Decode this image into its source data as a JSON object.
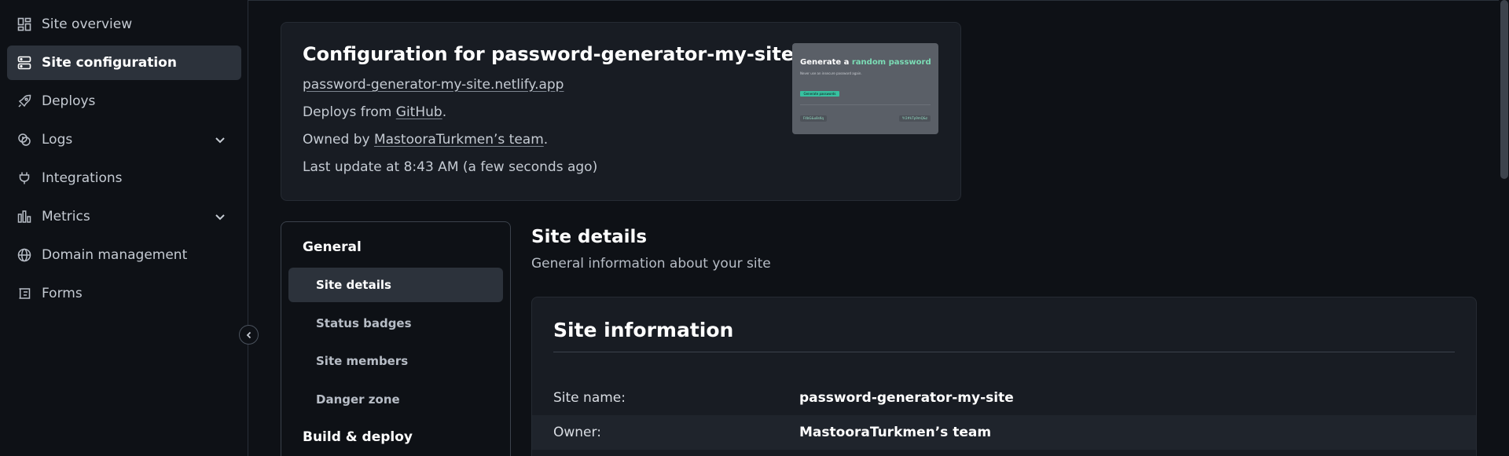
{
  "sidebar": {
    "items": [
      {
        "label": "Site overview",
        "icon": "grid-icon"
      },
      {
        "label": "Site configuration",
        "icon": "server-icon"
      },
      {
        "label": "Deploys",
        "icon": "rocket-icon"
      },
      {
        "label": "Logs",
        "icon": "logs-icon"
      },
      {
        "label": "Integrations",
        "icon": "plug-icon"
      },
      {
        "label": "Metrics",
        "icon": "bar-chart-icon"
      },
      {
        "label": "Domain management",
        "icon": "globe-icon"
      },
      {
        "label": "Forms",
        "icon": "form-icon"
      }
    ],
    "active_item": "Site configuration"
  },
  "config": {
    "title": "Configuration for password-generator-my-site",
    "url": "password-generator-my-site.netlify.app",
    "deploys_prefix": "Deploys from ",
    "deploys_link": "GitHub",
    "deploys_suffix": ".",
    "owned_prefix": "Owned by ",
    "owned_link": "MastooraTurkmen’s team",
    "owned_suffix": ".",
    "last_update": "Last update at 8:43 AM (a few seconds ago)",
    "thumbnail": {
      "title_start": "Generate a ",
      "title_accent": "random password",
      "subtitle": "Never use an insecure password again.",
      "button": "Generate passwords",
      "chip_left": "F4bG&u8sKq",
      "chip_right": "Yr2#kTp9mQ&z"
    }
  },
  "subnav": {
    "group_general": "General",
    "items": [
      "Site details",
      "Status badges",
      "Site members",
      "Danger zone"
    ],
    "group_build": "Build & deploy"
  },
  "content": {
    "title": "Site details",
    "subtitle": "General information about your site",
    "card_title": "Site information",
    "rows": [
      {
        "label": "Site name:",
        "value": "password-generator-my-site"
      },
      {
        "label": "Owner:",
        "value": "MastooraTurkmen’s team"
      }
    ]
  },
  "colors": {
    "background": "#0e1116",
    "card": "#181c23",
    "active": "#2c323b",
    "accent": "#7bdcb5"
  }
}
